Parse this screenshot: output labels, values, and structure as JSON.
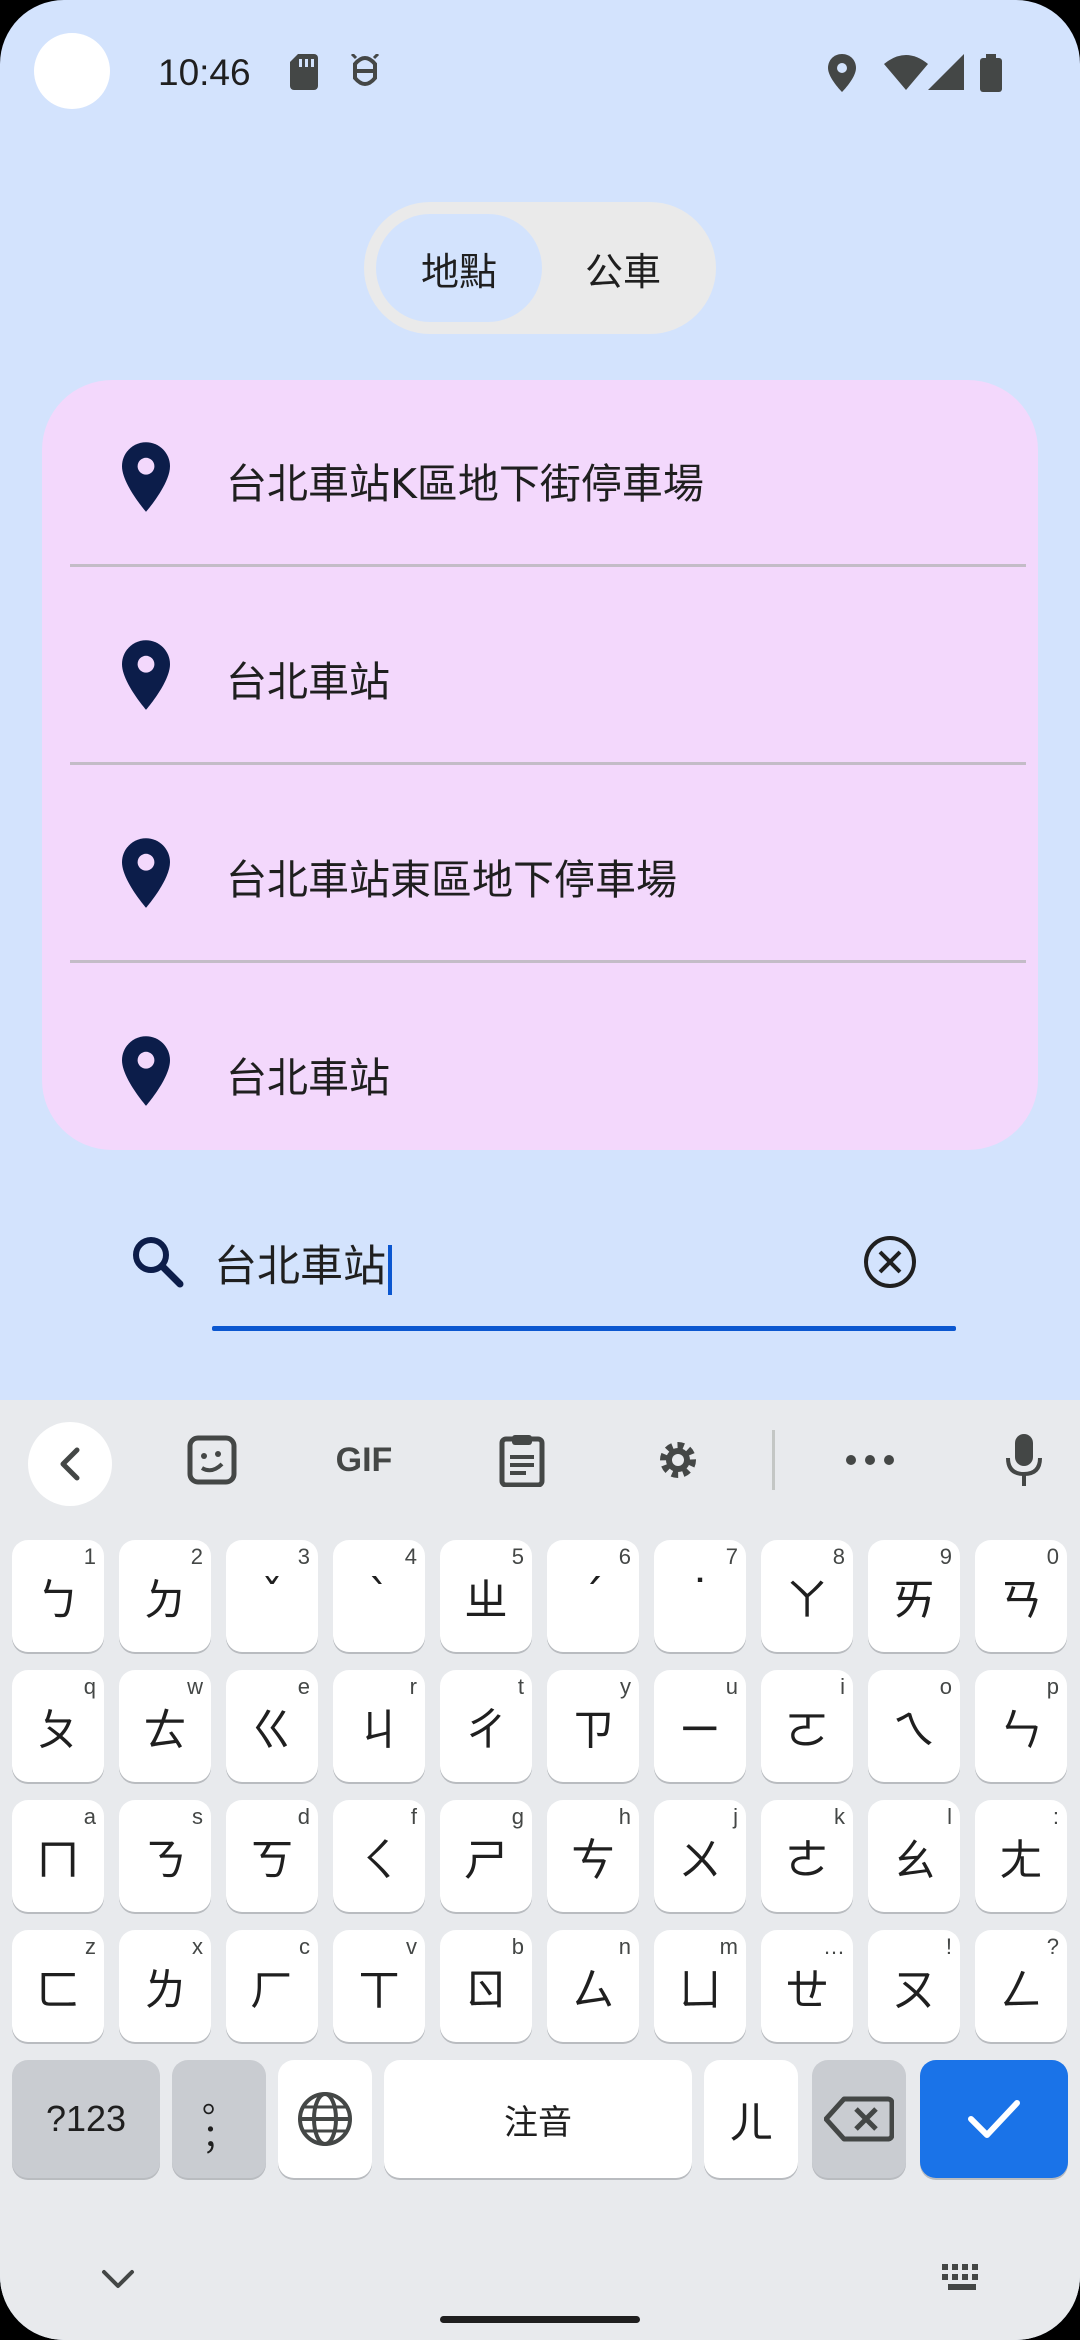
{
  "status_bar": {
    "time": "10:46"
  },
  "tabs": [
    {
      "label": "地點",
      "active": true
    },
    {
      "label": "公車",
      "active": false
    }
  ],
  "results": [
    {
      "label": "台北車站K區地下街停車場",
      "icon": "location-pin-icon"
    },
    {
      "label": "台北車站",
      "icon": "location-pin-icon"
    },
    {
      "label": "台北車站東區地下停車場",
      "icon": "location-pin-icon"
    },
    {
      "label": "台北車站",
      "icon": "location-pin-icon"
    }
  ],
  "search": {
    "value": "台北車站",
    "icon": "search-icon",
    "clear_icon": "clear-icon"
  },
  "keyboard": {
    "toolbar": {
      "gif_label": "GIF"
    },
    "rows": [
      [
        {
          "c": "ㄅ",
          "h": "1"
        },
        {
          "c": "ㄉ",
          "h": "2"
        },
        {
          "c": "ˇ",
          "h": "3"
        },
        {
          "c": "ˋ",
          "h": "4"
        },
        {
          "c": "ㄓ",
          "h": "5"
        },
        {
          "c": "ˊ",
          "h": "6"
        },
        {
          "c": "˙",
          "h": "7"
        },
        {
          "c": "ㄚ",
          "h": "8"
        },
        {
          "c": "ㄞ",
          "h": "9"
        },
        {
          "c": "ㄢ",
          "h": "0"
        }
      ],
      [
        {
          "c": "ㄆ",
          "h": "q"
        },
        {
          "c": "ㄊ",
          "h": "w"
        },
        {
          "c": "ㄍ",
          "h": "e"
        },
        {
          "c": "ㄐ",
          "h": "r"
        },
        {
          "c": "ㄔ",
          "h": "t"
        },
        {
          "c": "ㄗ",
          "h": "y"
        },
        {
          "c": "ㄧ",
          "h": "u"
        },
        {
          "c": "ㄛ",
          "h": "i"
        },
        {
          "c": "ㄟ",
          "h": "o"
        },
        {
          "c": "ㄣ",
          "h": "p"
        }
      ],
      [
        {
          "c": "ㄇ",
          "h": "a"
        },
        {
          "c": "ㄋ",
          "h": "s"
        },
        {
          "c": "ㄎ",
          "h": "d"
        },
        {
          "c": "ㄑ",
          "h": "f"
        },
        {
          "c": "ㄕ",
          "h": "g"
        },
        {
          "c": "ㄘ",
          "h": "h"
        },
        {
          "c": "ㄨ",
          "h": "j"
        },
        {
          "c": "ㄜ",
          "h": "k"
        },
        {
          "c": "ㄠ",
          "h": "l"
        },
        {
          "c": "ㄤ",
          "h": ":"
        }
      ],
      [
        {
          "c": "ㄈ",
          "h": "z"
        },
        {
          "c": "ㄌ",
          "h": "x"
        },
        {
          "c": "ㄏ",
          "h": "c"
        },
        {
          "c": "ㄒ",
          "h": "v"
        },
        {
          "c": "ㄖ",
          "h": "b"
        },
        {
          "c": "ㄙ",
          "h": "n"
        },
        {
          "c": "ㄩ",
          "h": "m"
        },
        {
          "c": "ㄝ",
          "h": "…"
        },
        {
          "c": "ㄡ",
          "h": "!"
        },
        {
          "c": "ㄥ",
          "h": "?"
        }
      ]
    ],
    "bottom": {
      "symbols_label": "?123",
      "punct_label": "。\n；",
      "space_label": "注音",
      "er_label": "ㄦ"
    }
  },
  "colors": {
    "accent": "#0b57d0",
    "background": "#d3e3fd",
    "list_background": "#f3d8fc",
    "enter_key": "#1a73e8"
  }
}
